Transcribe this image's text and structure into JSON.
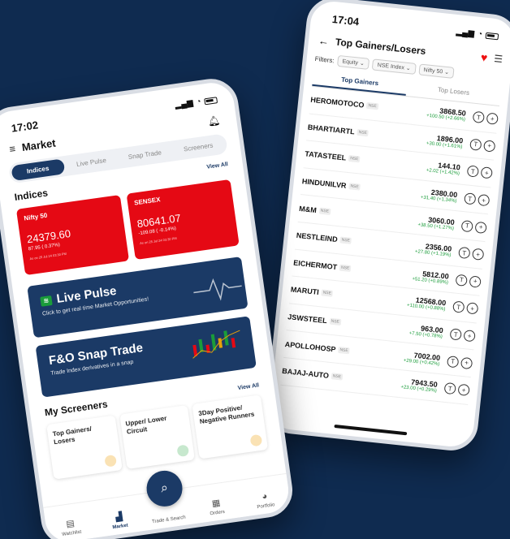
{
  "right_phone": {
    "time": "17:04",
    "title": "Top Gainers/Losers",
    "filters_label": "Filters:",
    "filters": [
      "Equity",
      "NSE Index",
      "Nifty 50"
    ],
    "tabs": [
      "Top Gainers",
      "Top Losers"
    ],
    "stocks": [
      {
        "name": "HEROMOTOCO",
        "price": "3868.50",
        "change": "+100.50 (+2.66%)"
      },
      {
        "name": "BHARTIARTL",
        "price": "1896.00",
        "change": "+30.00 (+1.61%)"
      },
      {
        "name": "TATASTEEL",
        "price": "144.10",
        "change": "+2.02 (+1.42%)"
      },
      {
        "name": "HINDUNILVR",
        "price": "2380.00",
        "change": "+31.40 (+1.34%)"
      },
      {
        "name": "M&M",
        "price": "3060.00",
        "change": "+38.50 (+1.27%)"
      },
      {
        "name": "NESTLEIND",
        "price": "2356.00",
        "change": "+27.80 (+1.19%)"
      },
      {
        "name": "EICHERMOT",
        "price": "5812.00",
        "change": "+51.20 (+0.89%)"
      },
      {
        "name": "MARUTI",
        "price": "12568.00",
        "change": "+110.00 (+0.88%)"
      },
      {
        "name": "JSWSTEEL",
        "price": "963.00",
        "change": "+7.50 (+0.78%)"
      },
      {
        "name": "APOLLOHOSP",
        "price": "7002.00",
        "change": "+29.00 (+0.42%)"
      },
      {
        "name": "BAJAJ-AUTO",
        "price": "7943.50",
        "change": "+23.00 (+0.29%)"
      }
    ],
    "btn_t": "T",
    "btn_plus": "+"
  },
  "left_phone": {
    "time": "17:02",
    "title": "Market",
    "tabs": [
      "Indices",
      "Live Pulse",
      "Snap Trade",
      "Screeners"
    ],
    "indices_title": "Indices",
    "view_all": "View All",
    "indices": [
      {
        "name": "Nifty 50",
        "value": "24379.60",
        "change": "87.95 ( 0.37%)",
        "time": "As on 25 Jul 24 03:30 PM"
      },
      {
        "name": "SENSEX",
        "value": "80641.07",
        "change": "-109.08 ( -0.14%)",
        "time": "As on 25 Jul 24 03:30 PM"
      }
    ],
    "live_pulse": {
      "title": "Live Pulse",
      "subtitle": "Click to get real time Market Opportunities!"
    },
    "snap_trade": {
      "title": "F&O Snap Trade",
      "subtitle": "Trade Index derivatives in a snap"
    },
    "screeners_title": "My Screeners",
    "screeners": [
      "Top Gainers/ Losers",
      "Upper/ Lower Circuit",
      "3Day Positive/ Negative Runners"
    ],
    "nav": [
      "Watchlist",
      "Market",
      "Trade & Search",
      "Orders",
      "Portfolio"
    ]
  }
}
